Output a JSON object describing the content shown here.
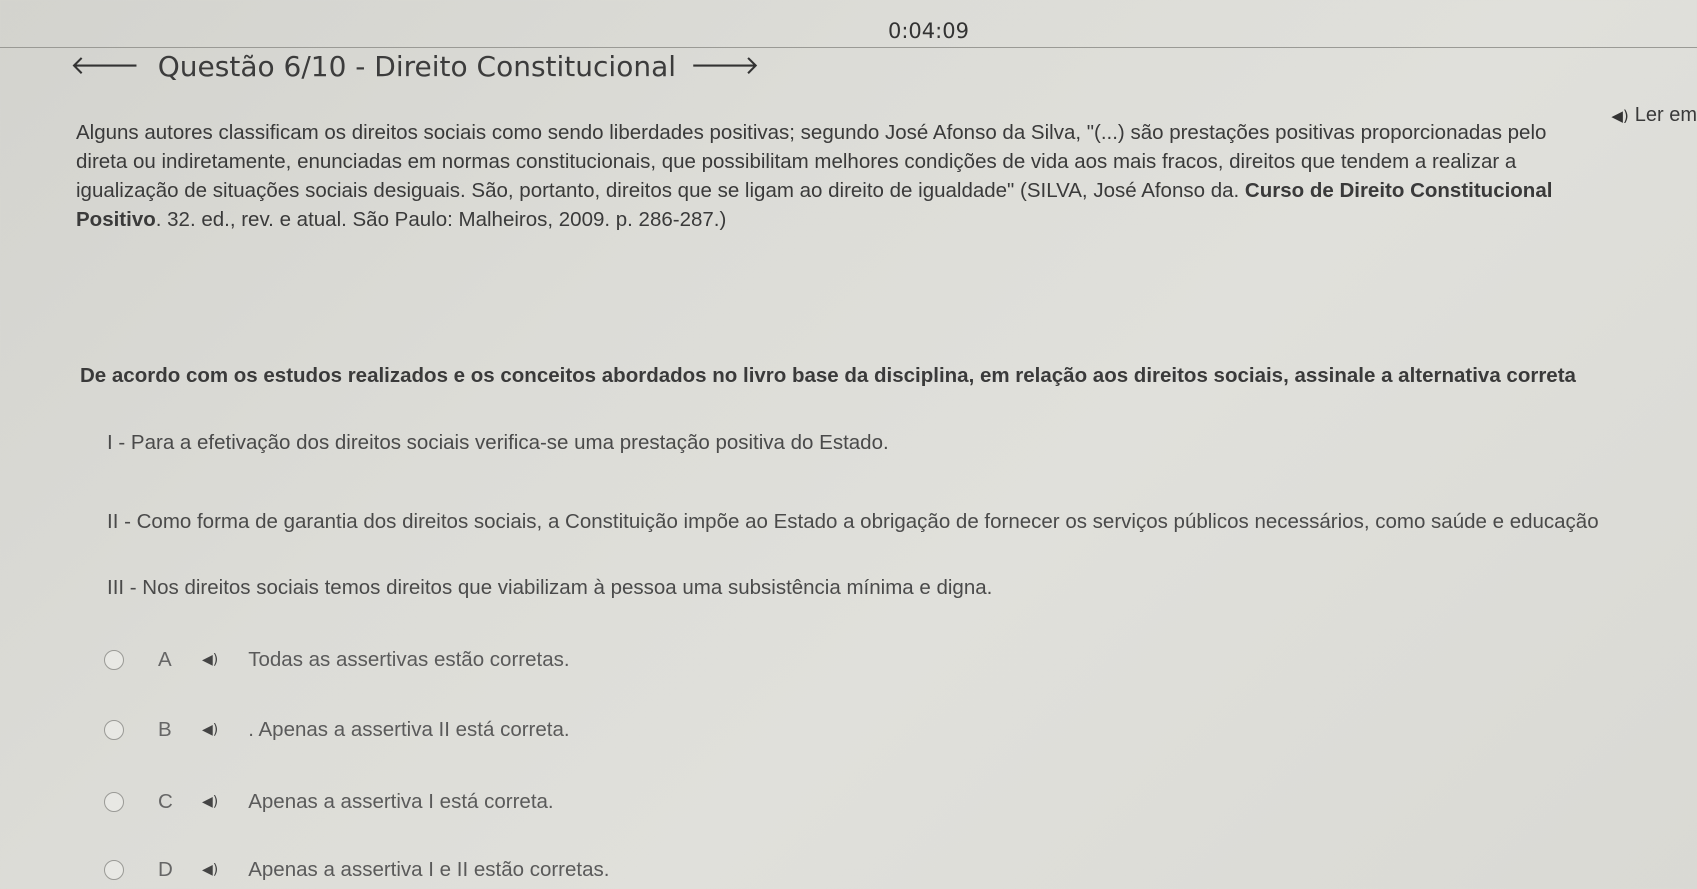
{
  "timer": "0:04:09",
  "header": {
    "prev_arrow": "🡐",
    "title": "Questão 6/10 - Direito Constitucional",
    "next_arrow": "🡒"
  },
  "read_aloud": {
    "icon": "speaker-icon",
    "label": "Ler em"
  },
  "passage": {
    "line1": "Alguns autores classificam os direitos sociais como sendo liberdades positivas; segundo José Afonso da Silva, \"(...) são prestações positivas proporcionadas pelo",
    "line2": "direta ou indiretamente, enunciadas em normas constitucionais, que possibilitam melhores condições de vida aos mais fracos, direitos que tendem a realizar a",
    "line3_plain": "igualização de situações sociais desiguais. São, portanto, direitos que se ligam ao direito de igualdade\" (SILVA, José Afonso da. ",
    "line3_bold": "Curso de Direito Constitucional",
    "line4_bold": "Positivo",
    "line4_plain": ". 32. ed., rev. e atual. São Paulo: Malheiros, 2009. p. 286-287.)"
  },
  "question": "De acordo com os estudos realizados e os conceitos abordados no livro base da disciplina, em relação aos direitos sociais, assinale a alternativa correta",
  "assertions": [
    "I - Para a efetivação dos direitos sociais verifica-se uma prestação positiva do Estado.",
    "II - Como forma de garantia dos direitos sociais, a Constituição impõe ao Estado a obrigação de fornecer os serviços públicos necessários, como saúde e educação",
    "III - Nos direitos sociais temos direitos que viabilizam à pessoa uma subsistência mínima e digna."
  ],
  "options": [
    {
      "letter": "A",
      "text": "Todas as assertivas estão corretas."
    },
    {
      "letter": "B",
      "text": ". Apenas a assertiva II está correta."
    },
    {
      "letter": "C",
      "text": "Apenas a assertiva I está correta."
    },
    {
      "letter": "D",
      "text": "Apenas a assertiva I e II estão corretas."
    }
  ],
  "option_speaker_glyph": "◀)",
  "read_speaker_glyph": "◀)"
}
